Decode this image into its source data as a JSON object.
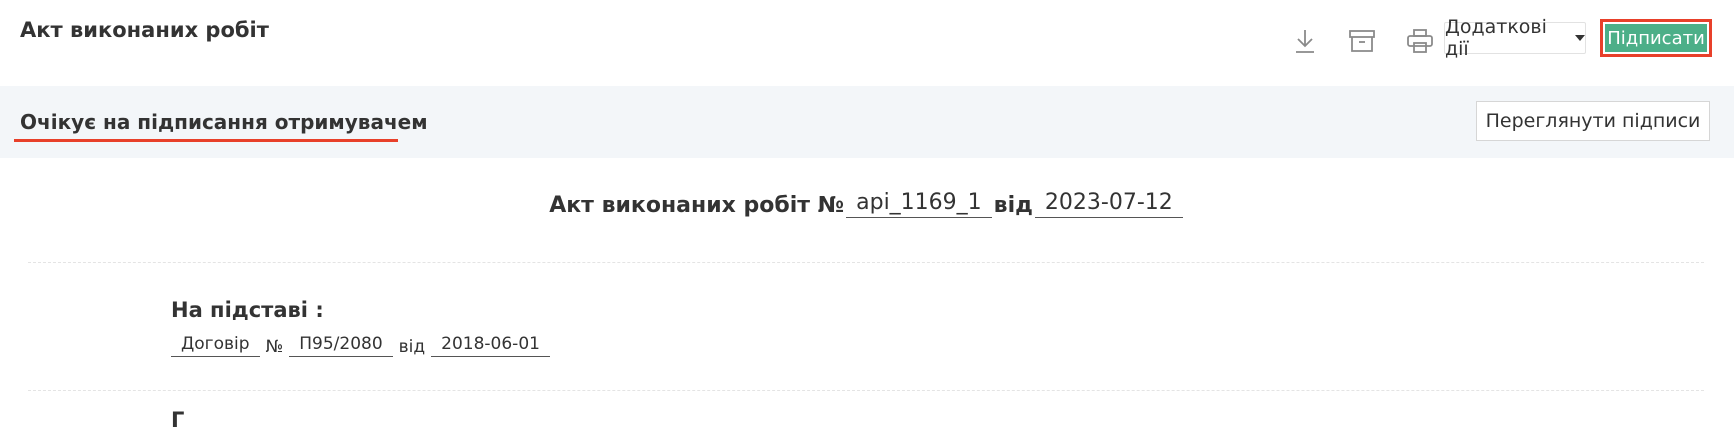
{
  "header": {
    "title": "Акт виконаних робіт",
    "actions_dropdown_label": "Додаткові дії",
    "sign_button_label": "Підписати"
  },
  "toolbar_icons": [
    "download-icon",
    "archive-icon",
    "printer-icon"
  ],
  "status": {
    "text": "Очікує на підписання отримувачем",
    "view_signatures_label": "Переглянути підписи"
  },
  "document": {
    "heading_prefix": "Акт виконаних робіт №",
    "number": "api_1169_1",
    "from_word": "від",
    "date": "2023-07-12",
    "basis_label": "На підставі :",
    "basis": {
      "doc_type": "Договір",
      "number_sign": "№",
      "number": "П95/2080",
      "from_word": "від",
      "date": "2018-06-01"
    },
    "next_section_fragment": "Г"
  },
  "colors": {
    "accent_green": "#4caf88",
    "highlight_red": "#e8402a",
    "status_bg": "#f3f6f9"
  }
}
